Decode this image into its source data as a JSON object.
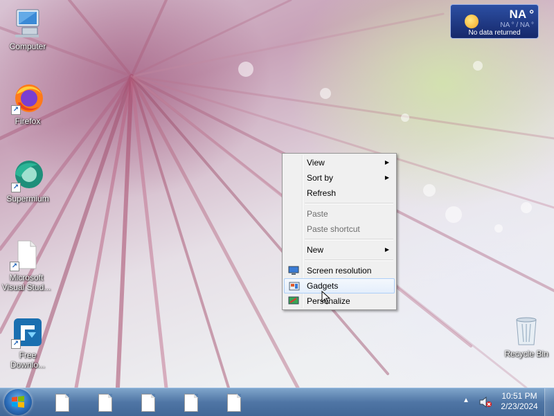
{
  "desktop": {
    "icons": [
      {
        "label": "Computer",
        "icon": "computer-icon"
      },
      {
        "label": "Firefox",
        "icon": "firefox-icon"
      },
      {
        "label": "Supermium",
        "icon": "supermium-icon"
      },
      {
        "label": "Microsoft Visual Stud...",
        "icon": "document-icon"
      },
      {
        "label": "Free Downlo...",
        "icon": "free-download-manager-icon"
      },
      {
        "label": "Recycle Bin",
        "icon": "recycle-bin-icon"
      }
    ]
  },
  "weather_gadget": {
    "temperature": "NA °",
    "range": "NA ° / NA °",
    "status": "No data returned",
    "icon": "sun-icon"
  },
  "context_menu": {
    "items": [
      {
        "label": "View",
        "has_submenu": true,
        "enabled": true
      },
      {
        "label": "Sort by",
        "has_submenu": true,
        "enabled": true
      },
      {
        "label": "Refresh",
        "has_submenu": false,
        "enabled": true
      },
      {
        "label": "Paste",
        "has_submenu": false,
        "enabled": false
      },
      {
        "label": "Paste shortcut",
        "has_submenu": false,
        "enabled": false
      },
      {
        "label": "New",
        "has_submenu": true,
        "enabled": true
      },
      {
        "label": "Screen resolution",
        "icon": "screen-resolution-icon",
        "enabled": true
      },
      {
        "label": "Gadgets",
        "icon": "gadgets-icon",
        "enabled": true,
        "highlighted": true
      },
      {
        "label": "Personalize",
        "icon": "personalize-icon",
        "enabled": true
      }
    ],
    "submenu_arrow": "▶"
  },
  "taskbar": {
    "start_icon": "windows-logo-icon",
    "pinned_items": [
      "document-icon",
      "document-icon",
      "document-icon",
      "document-icon",
      "document-icon"
    ],
    "tray_arrow": "▲",
    "volume_icon": "volume-muted-icon",
    "clock": {
      "time": "10:51 PM",
      "date": "2/23/2024"
    }
  },
  "colors": {
    "taskbar": "#4a7aaa",
    "menu_background": "#f0f0f0",
    "menu_highlight": "#e4eefb",
    "weather_background": "#1f3a8a"
  }
}
